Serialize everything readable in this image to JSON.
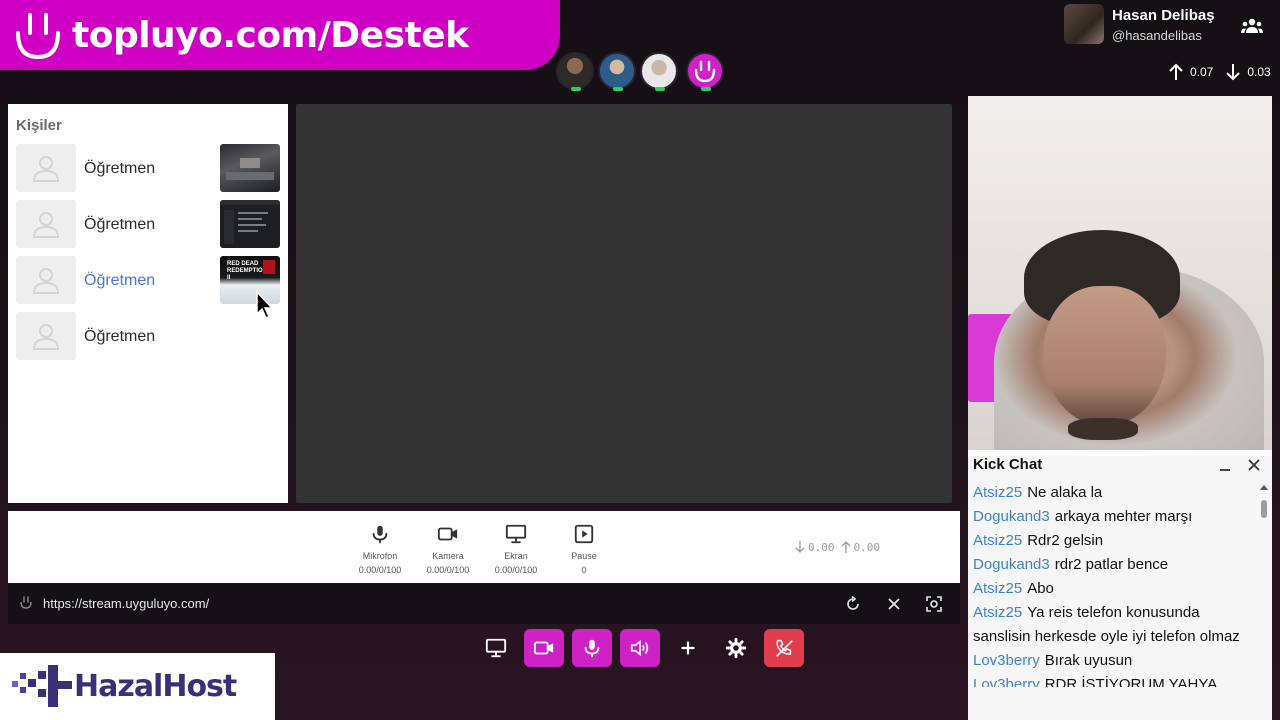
{
  "banner": {
    "url_text": "topluyo.com/Destek",
    "icon": "smiley-logo-icon"
  },
  "participants": [
    {
      "name": "participant-1",
      "status_color": "#28d25a"
    },
    {
      "name": "participant-2",
      "status_color": "#28d25a"
    },
    {
      "name": "participant-3",
      "status_color": "#28d25a"
    },
    {
      "name": "participant-4",
      "status_color": "#28d25a"
    }
  ],
  "profile": {
    "name": "Hasan Delibaş",
    "handle": "@hasandelibas"
  },
  "network": {
    "up": "0.07",
    "down": "0.03"
  },
  "contacts": {
    "title": "Kişiler",
    "items": [
      {
        "name": "Öğretmen",
        "active": false
      },
      {
        "name": "Öğretmen",
        "active": false
      },
      {
        "name": "Öğretmen",
        "active": true,
        "thumb_text": "RED DEAD REDEMPTION II"
      },
      {
        "name": "Öğretmen",
        "active": false
      }
    ]
  },
  "media": {
    "mic": {
      "label": "Mikrofon",
      "value": "0.00/0/100"
    },
    "camera": {
      "label": "Kamera",
      "value": "0.00/0/100"
    },
    "screen": {
      "label": "Ekran",
      "value": "0.00/0/100"
    },
    "pause": {
      "label": "Pause",
      "value": "0"
    },
    "rate_down": "0.00",
    "rate_up": "0.00"
  },
  "urlbar": {
    "url": "https://stream.uyguluyo.com/"
  },
  "chat": {
    "title": "Kick Chat",
    "messages": [
      {
        "user": "Atsiz25",
        "text": "Ne alaka la"
      },
      {
        "user": "Dogukand3",
        "text": "arkaya mehter marşı"
      },
      {
        "user": "Atsiz25",
        "text": "Rdr2 gelsin"
      },
      {
        "user": "Dogukand3",
        "text": "rdr2 patlar bence"
      },
      {
        "user": "Atsiz25",
        "text": "Abo"
      },
      {
        "user": "Atsiz25",
        "text": "Ya reis telefon konusunda sanslisin herkesde oyle iyi telefon olmaz"
      },
      {
        "user": "Lov3berry",
        "text": "Bırak uyusun"
      },
      {
        "user": "Lov3berry",
        "text": "RDR İSTİYORUM YAHYA"
      }
    ]
  },
  "brand": {
    "text": "HazalHost"
  },
  "colors": {
    "accent": "#cf00c4",
    "danger": "#e23d4d",
    "chat_user": "#3e84c4",
    "active_contact": "#4a77d6"
  }
}
